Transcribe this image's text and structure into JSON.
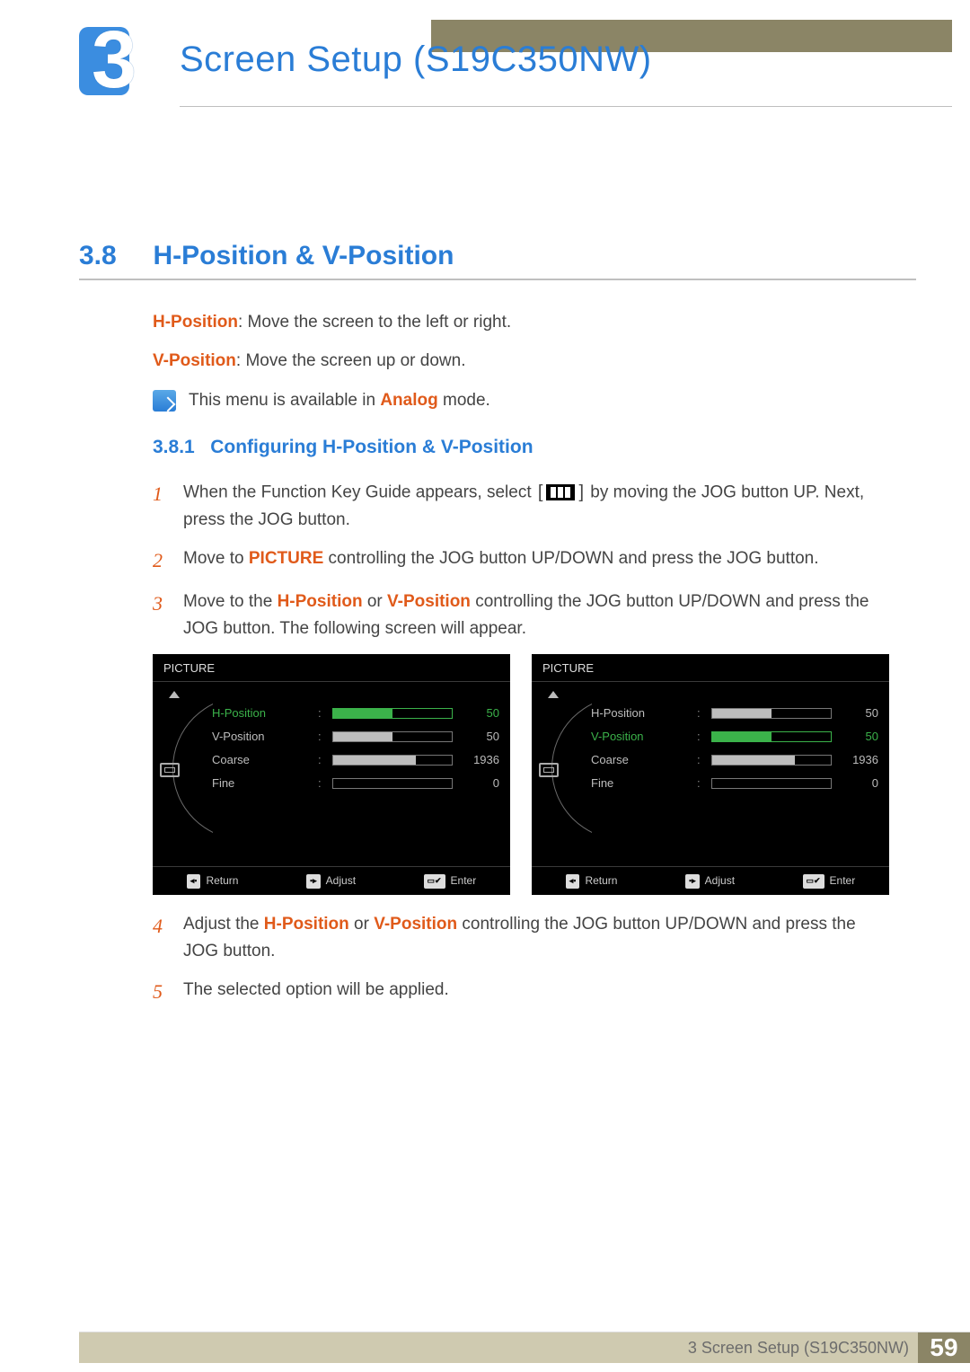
{
  "chapter": {
    "number": "3",
    "title": "Screen Setup (S19C350NW)"
  },
  "section": {
    "number": "3.8",
    "title": "H-Position & V-Position"
  },
  "intro": {
    "hpos_label": "H-Position",
    "hpos_text": ": Move the screen to the left or right.",
    "vpos_label": "V-Position",
    "vpos_text": ": Move the screen up or down."
  },
  "note": {
    "prefix": "This menu is available in ",
    "highlight": "Analog",
    "suffix": " mode."
  },
  "subsection": {
    "number": "3.8.1",
    "title": "Configuring H-Position & V-Position"
  },
  "steps": {
    "s1a": "When the Function Key Guide appears, select ",
    "s1b": " by moving the JOG button UP. Next, press the JOG button.",
    "s2a": "Move to ",
    "s2_hl": "PICTURE",
    "s2b": " controlling the JOG button UP/DOWN and press the JOG button.",
    "s3a": "Move to the ",
    "s3_hl1": "H-Position",
    "s3_mid": " or  ",
    "s3_hl2": "V-Position",
    "s3b": " controlling the JOG button UP/DOWN and press the JOG button. The following screen will appear.",
    "s4a": "Adjust the ",
    "s4_hl1": "H-Position",
    "s4_mid": " or ",
    "s4_hl2": "V-Position",
    "s4b": " controlling the JOG button UP/DOWN and press the JOG button.",
    "s5": "The selected option will be applied."
  },
  "osd": {
    "title": "PICTURE",
    "items": [
      {
        "label": "H-Position",
        "value": "50",
        "fill": 50
      },
      {
        "label": "V-Position",
        "value": "50",
        "fill": 50
      },
      {
        "label": "Coarse",
        "value": "1936",
        "fill": 70
      },
      {
        "label": "Fine",
        "value": "0",
        "fill": 0
      }
    ],
    "footer": {
      "return": "Return",
      "adjust": "Adjust",
      "enter": "Enter"
    },
    "left_selected_index": 0,
    "right_selected_index": 1
  },
  "footer": {
    "text": "3 Screen Setup (S19C350NW)",
    "page": "59"
  }
}
